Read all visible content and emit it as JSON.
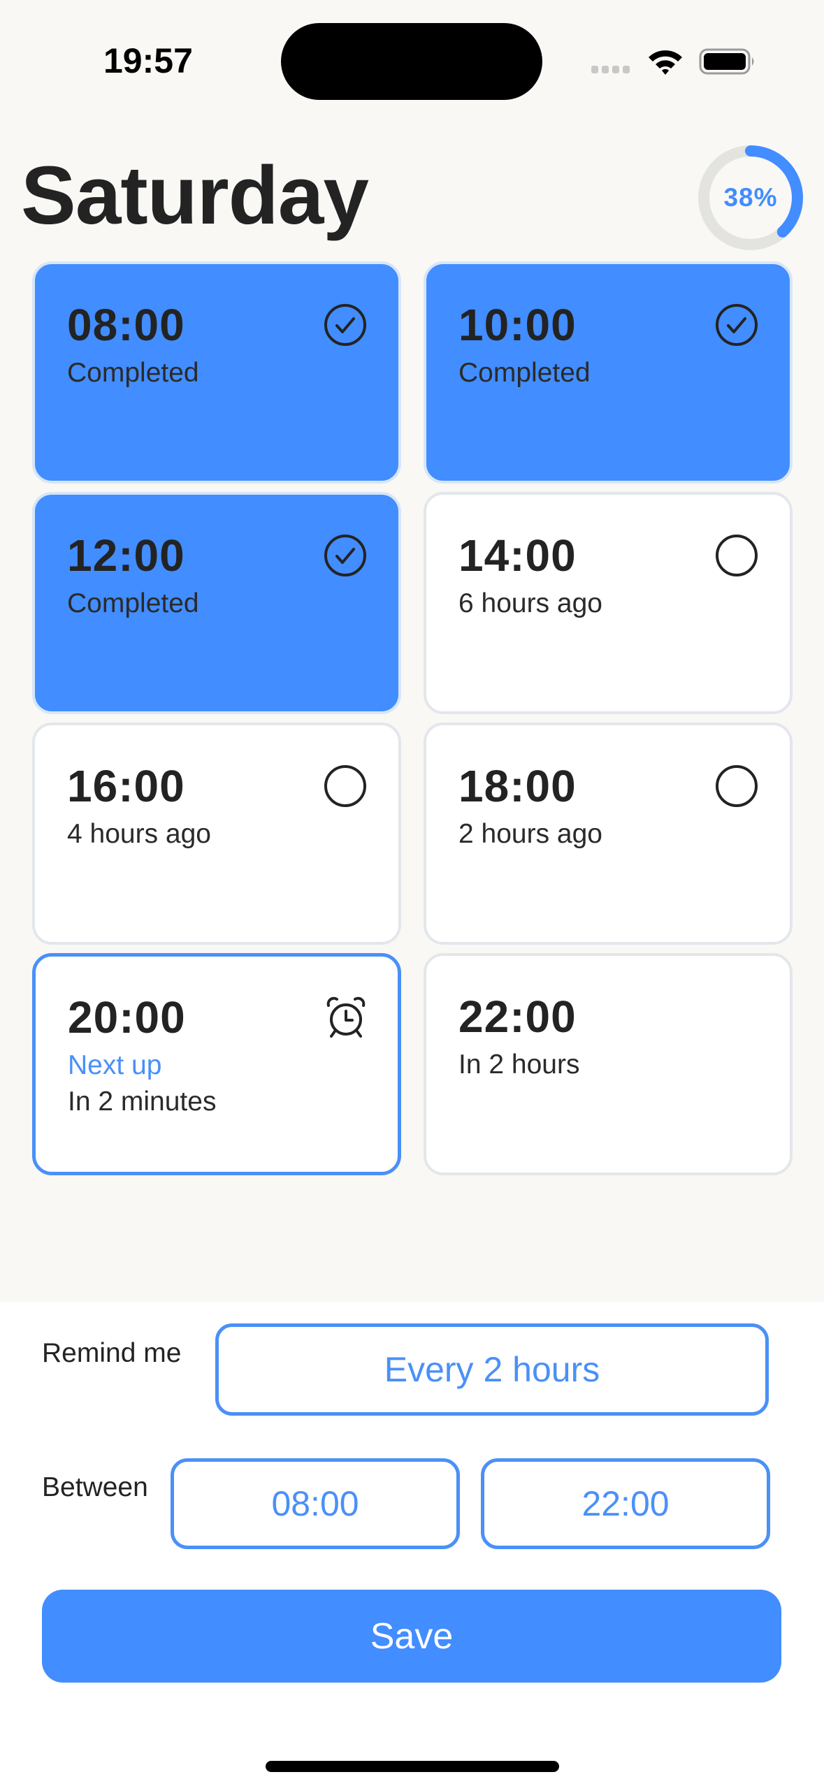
{
  "status_bar": {
    "time": "19:57",
    "icons": [
      "cellular-signal-icon",
      "wifi-icon",
      "battery-icon"
    ]
  },
  "header": {
    "title": "Saturday",
    "progress_percent": 38,
    "progress_label": "38%"
  },
  "colors": {
    "accent": "#428DFF",
    "accent_text": "#4A90F7",
    "background": "#F9F8F5",
    "card_border": "#E3E7EB",
    "ring_track": "#E3E3E0"
  },
  "schedule": [
    {
      "time": "08:00",
      "status": "completed",
      "subtitle": "Completed",
      "detail": "",
      "icon": "checkmark-circle-icon"
    },
    {
      "time": "10:00",
      "status": "completed",
      "subtitle": "Completed",
      "detail": "",
      "icon": "checkmark-circle-icon"
    },
    {
      "time": "12:00",
      "status": "completed",
      "subtitle": "Completed",
      "detail": "",
      "icon": "checkmark-circle-icon"
    },
    {
      "time": "14:00",
      "status": "missed",
      "subtitle": "6 hours ago",
      "detail": "",
      "icon": "empty-circle-icon"
    },
    {
      "time": "16:00",
      "status": "missed",
      "subtitle": "4 hours ago",
      "detail": "",
      "icon": "empty-circle-icon"
    },
    {
      "time": "18:00",
      "status": "missed",
      "subtitle": "2 hours ago",
      "detail": "",
      "icon": "empty-circle-icon"
    },
    {
      "time": "20:00",
      "status": "next",
      "subtitle": "Next up",
      "detail": "In 2 minutes",
      "icon": "alarm-clock-icon"
    },
    {
      "time": "22:00",
      "status": "upcoming",
      "subtitle": "In 2 hours",
      "detail": "",
      "icon": ""
    }
  ],
  "settings": {
    "remind_label": "Remind me",
    "remind_value": "Every 2 hours",
    "between_label": "Between",
    "start_time": "08:00",
    "end_time": "22:00",
    "save_label": "Save"
  }
}
